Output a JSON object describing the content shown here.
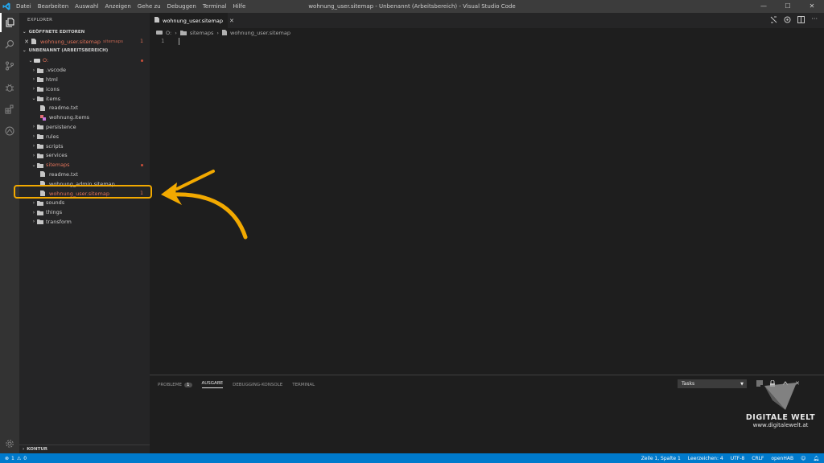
{
  "titlebar": {
    "menu": [
      "Datei",
      "Bearbeiten",
      "Auswahl",
      "Anzeigen",
      "Gehe zu",
      "Debuggen",
      "Terminal",
      "Hilfe"
    ],
    "window_title": "wohnung_user.sitemap - Unbenannt (Arbeitsbereich) - Visual Studio Code",
    "controls": [
      "—",
      "☐",
      "✕"
    ]
  },
  "sidebar": {
    "title": "EXPLORER",
    "open_editors": {
      "header": "GEÖFFNETE EDITOREN",
      "item_name": "wohnung_user.sitemap",
      "item_folder": "sitemaps",
      "item_badge": "1"
    },
    "workspace": {
      "header": "UNBENANNT (ARBEITSBEREICH)",
      "root": "O:",
      "items": [
        {
          "label": ".vscode"
        },
        {
          "label": "html"
        },
        {
          "label": "icons"
        },
        {
          "label": "items"
        },
        {
          "label": "readme.txt"
        },
        {
          "label": "wohnung.items"
        },
        {
          "label": "persistence"
        },
        {
          "label": "rules"
        },
        {
          "label": "scripts"
        },
        {
          "label": "services"
        },
        {
          "label": "sitemaps"
        },
        {
          "label": "readme.txt"
        },
        {
          "label": "wohnung_admin.sitemap"
        },
        {
          "label": "wohnung_user.sitemap",
          "badge": "1"
        },
        {
          "label": "sounds"
        },
        {
          "label": "things"
        },
        {
          "label": "transform"
        }
      ]
    },
    "outline_label": "KONTUR"
  },
  "editor": {
    "tab_label": "wohnung_user.sitemap",
    "breadcrumb": [
      "O:",
      "sitemaps",
      "wohnung_user.sitemap"
    ],
    "line_number": "1"
  },
  "panel": {
    "tabs": [
      "PROBLEME",
      "AUSGABE",
      "DEBUGGING-KONSOLE",
      "TERMINAL"
    ],
    "problems_count": "1",
    "task_select": "Tasks"
  },
  "statusbar": {
    "errors": "1",
    "warnings": "0",
    "position": "Zeile 1, Spalte 1",
    "indent": "Leerzeichen: 4",
    "encoding": "UTF-8",
    "eol": "CRLF",
    "language": "openHAB"
  },
  "watermark": {
    "title": "DIGITALE WELT",
    "url": "www.digitalewelt.at"
  },
  "colors": {
    "accent": "#007acc",
    "highlight": "#f2a900",
    "modified": "#e2735a"
  }
}
